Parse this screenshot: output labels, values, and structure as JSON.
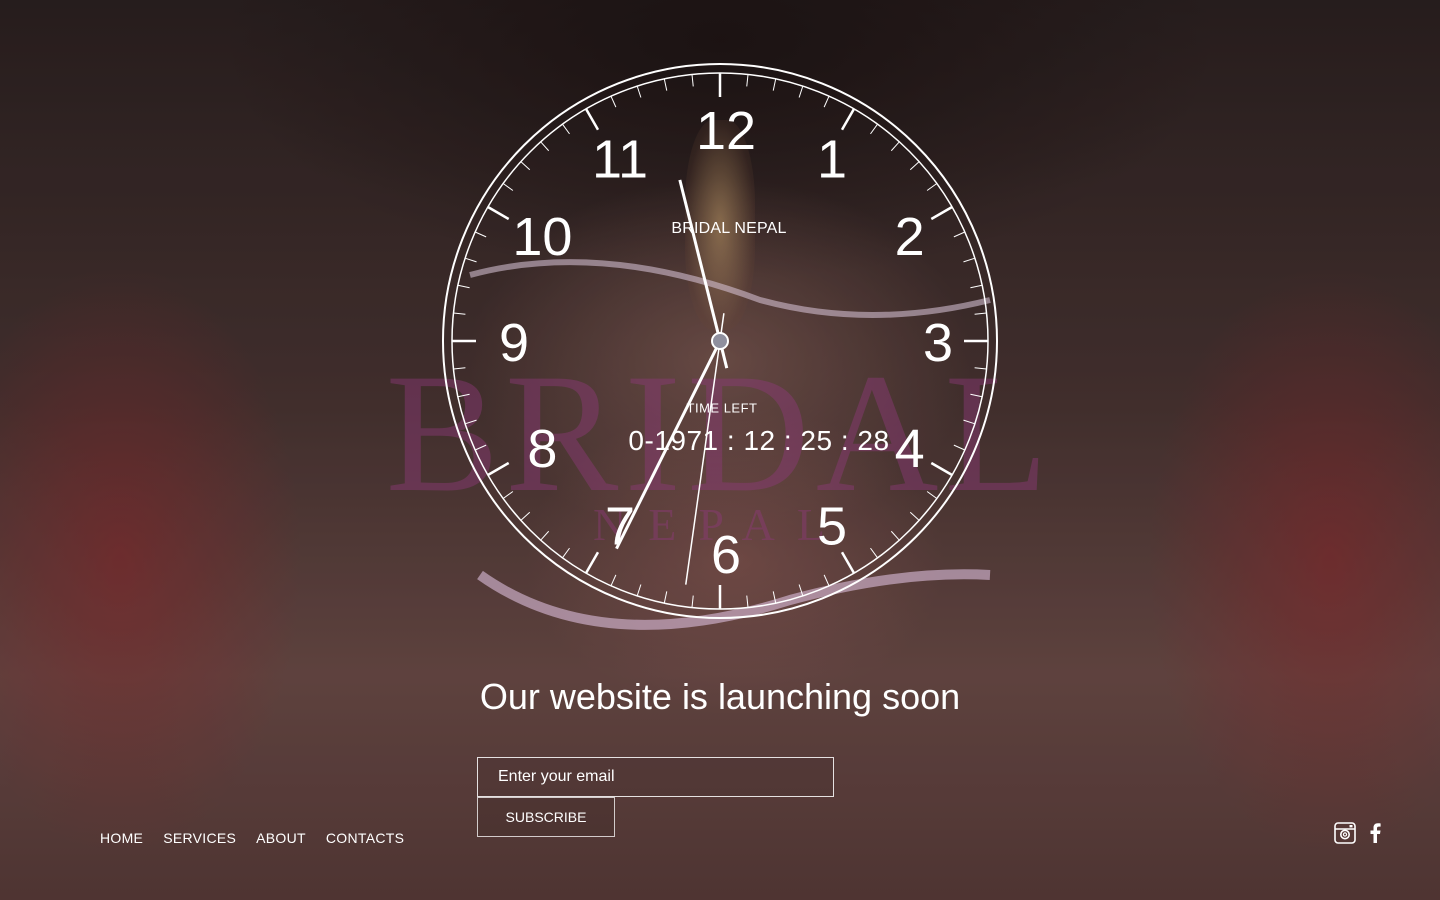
{
  "brand": {
    "name": "BRIDAL NEPAL"
  },
  "clock": {
    "numerals": [
      "12",
      "1",
      "2",
      "3",
      "4",
      "5",
      "6",
      "7",
      "8",
      "9",
      "10",
      "11"
    ],
    "hour_hand_deg": 206.5,
    "minute_hand_deg": 346,
    "second_hand_deg": 188
  },
  "countdown": {
    "label": "TIME LEFT",
    "value": "0-1971 : 12 : 25 : 28"
  },
  "headline": "Our website is launching soon",
  "subscribe": {
    "placeholder": "Enter your email",
    "button_label": "SUBSCRIBE"
  },
  "nav": {
    "items": [
      {
        "label": "HOME"
      },
      {
        "label": "SERVICES"
      },
      {
        "label": "ABOUT"
      },
      {
        "label": "CONTACTS"
      }
    ]
  },
  "social": {
    "icons": [
      "instagram-icon",
      "facebook-icon"
    ]
  },
  "watermark": {
    "line1": "BRIDAL",
    "line2": "NEPAL"
  },
  "colors": {
    "watermark_purple": "#8e3a7a",
    "text": "#ffffff"
  }
}
